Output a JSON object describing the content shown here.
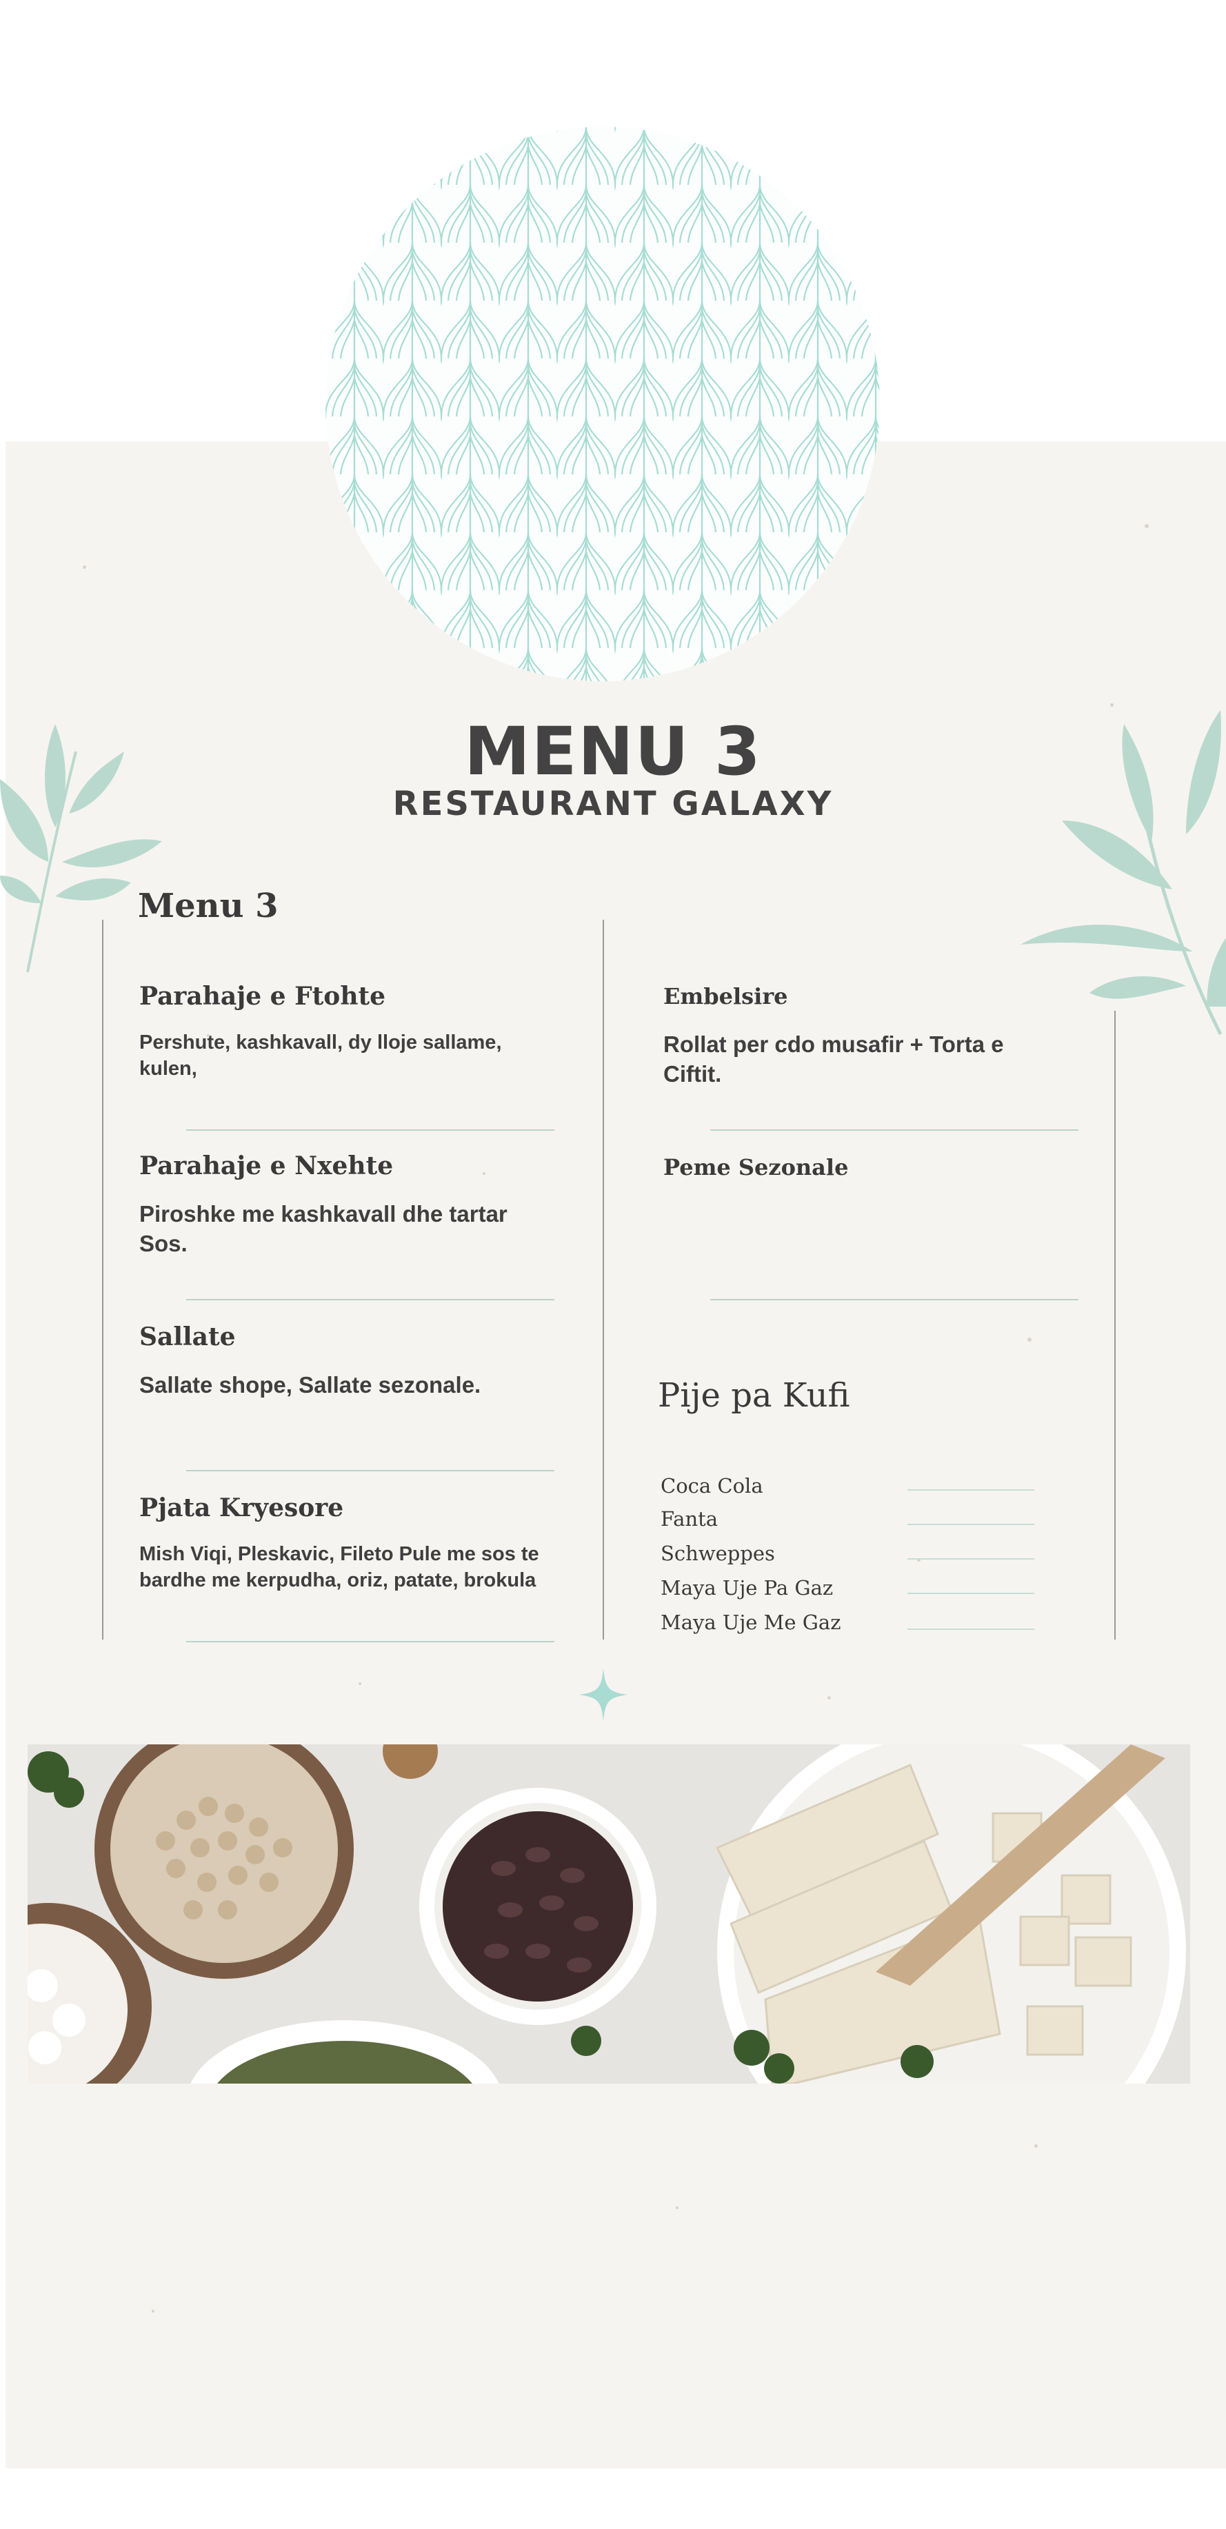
{
  "header": {
    "title": "MENU 3",
    "subtitle": "RESTAURANT GALAXY"
  },
  "menu": {
    "heading": "Menu 3",
    "left": [
      {
        "title": "Parahaje e Ftohte",
        "desc": "Pershute, kashkavall, dy lloje sallame, kulen,"
      },
      {
        "title": "Parahaje e Nxehte",
        "desc": "Piroshke me kashkavall dhe tartar Sos."
      },
      {
        "title": "Sallate",
        "desc": "Sallate shope, Sallate sezonale."
      },
      {
        "title": "Pjata Kryesore",
        "desc": "Mish Viqi, Pleskavic, Fileto Pule me sos te bardhe me kerpudha, oriz, patate, brokula"
      }
    ],
    "right": [
      {
        "title": "Embelsire",
        "desc": "Rollat per cdo musafir + Torta e Ciftit."
      },
      {
        "title": "Peme Sezonale",
        "desc": ""
      }
    ],
    "drinks": {
      "heading": "Pije pa Kufi",
      "items": [
        "Coca Cola",
        "Fanta",
        "Schweppes",
        "Maya Uje Pa Gaz",
        "Maya Uje Me Gaz"
      ]
    }
  },
  "colors": {
    "accent": "#a8dcd3",
    "leaf": "#b9d9cf",
    "text": "#3f3f3f",
    "paper": "#f6f4f1"
  },
  "icons": {
    "decor_pattern": "scallop-pattern",
    "leaves": "leaf-branch-icon",
    "sparkle": "sparkle-icon"
  },
  "photo": {
    "subject": "food-photo"
  }
}
